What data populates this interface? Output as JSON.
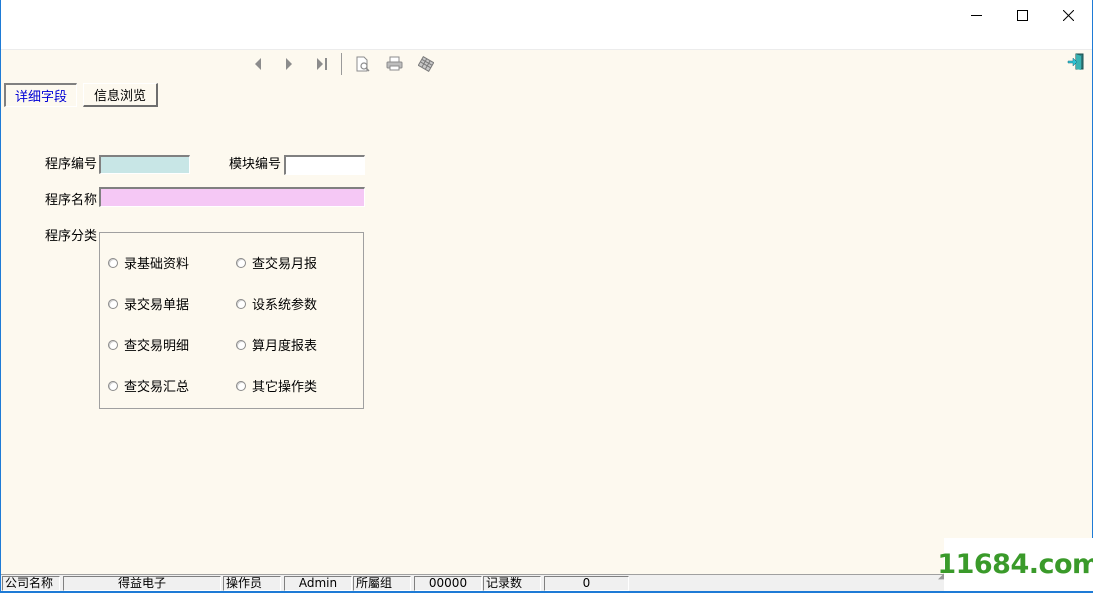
{
  "window": {
    "controls": {
      "minimize_icon": "minimize-icon",
      "maximize_icon": "maximize-icon",
      "close_icon": "close-icon"
    }
  },
  "toolbar": {
    "buttons": [
      {
        "name": "previous-record-button",
        "icon": "triangle-left-icon"
      },
      {
        "name": "next-record-button",
        "icon": "triangle-right-icon"
      },
      {
        "name": "last-record-button",
        "icon": "skip-to-end-icon"
      },
      {
        "name": "print-preview-button",
        "icon": "print-preview-icon"
      },
      {
        "name": "print-button",
        "icon": "printer-icon"
      },
      {
        "name": "export-button",
        "icon": "export-grid-icon"
      }
    ],
    "exit_icon": "exit-door-icon"
  },
  "tabs": [
    {
      "label": "详细字段",
      "active": true
    },
    {
      "label": "信息浏览",
      "active": false
    }
  ],
  "form": {
    "program_code": {
      "label": "程序编号",
      "value": "",
      "color": "#c8e6e6"
    },
    "module_code": {
      "label": "模块编号",
      "value": "",
      "color": "#ffffff"
    },
    "program_name": {
      "label": "程序名称",
      "value": "",
      "color": "#f5c8f5"
    },
    "program_category": {
      "label": "程序分类",
      "options": [
        {
          "label": "录基础资料",
          "selected": false
        },
        {
          "label": "查交易月报",
          "selected": false
        },
        {
          "label": "录交易单据",
          "selected": false
        },
        {
          "label": "设系统参数",
          "selected": false
        },
        {
          "label": "查交易明细",
          "selected": false
        },
        {
          "label": "算月度报表",
          "selected": false
        },
        {
          "label": "查交易汇总",
          "selected": false
        },
        {
          "label": "其它操作类",
          "selected": false
        }
      ]
    }
  },
  "statusbar": {
    "company_label": "公司名称",
    "company_value": "得益电子",
    "operator_label": "操作员",
    "operator_value": "Admin",
    "group_label": "所屬组",
    "group_value": "00000",
    "records_label": "记录数",
    "records_value": "0"
  },
  "watermark": "11684.com",
  "colors": {
    "background": "#fdf9ef",
    "active_tab_text": "#0000d6",
    "window_border": "#1e7bd6",
    "watermark": "#3a9a2a"
  }
}
